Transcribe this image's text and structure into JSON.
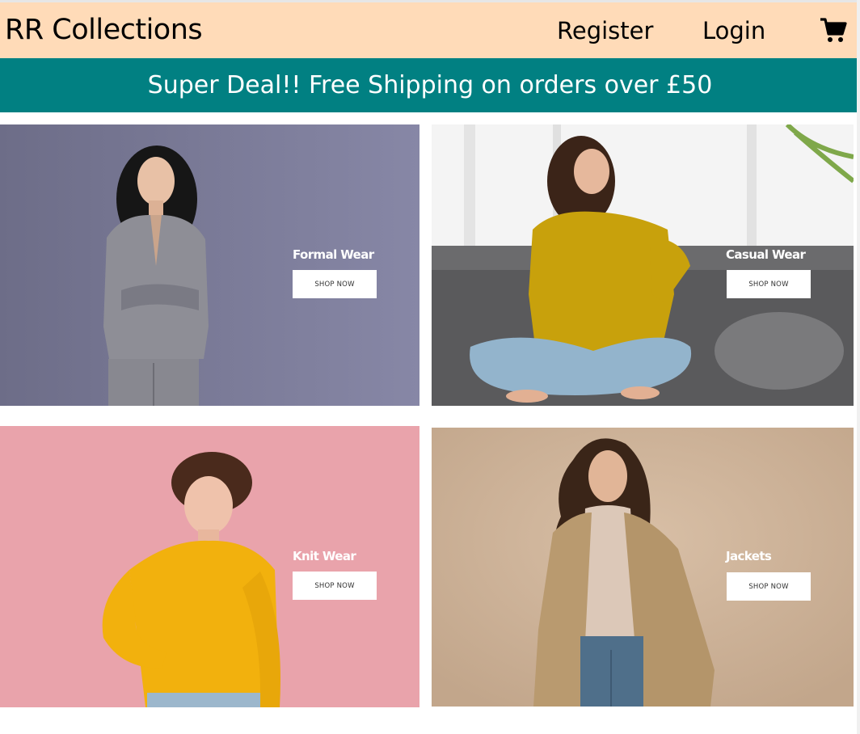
{
  "header": {
    "brand": "RR Collections",
    "register_label": "Register",
    "login_label": "Login",
    "cart_icon": "shopping-cart-icon"
  },
  "banner": {
    "text": "Super Deal!! Free Shipping on orders over £50"
  },
  "categories": [
    {
      "title": "Formal Wear",
      "button_label": "SHOP NOW"
    },
    {
      "title": "Casual Wear",
      "button_label": "SHOP NOW"
    },
    {
      "title": "Knit Wear",
      "button_label": "SHOP NOW"
    },
    {
      "title": "Jackets",
      "button_label": "SHOP NOW"
    }
  ],
  "colors": {
    "navbar_bg": "#ffdbb8",
    "banner_bg": "#018082",
    "formal_bg": "#7e7e9c",
    "casual_bg": "#e8e8e8",
    "knit_bg": "#e9a3ab",
    "jackets_bg": "#cbb198"
  }
}
